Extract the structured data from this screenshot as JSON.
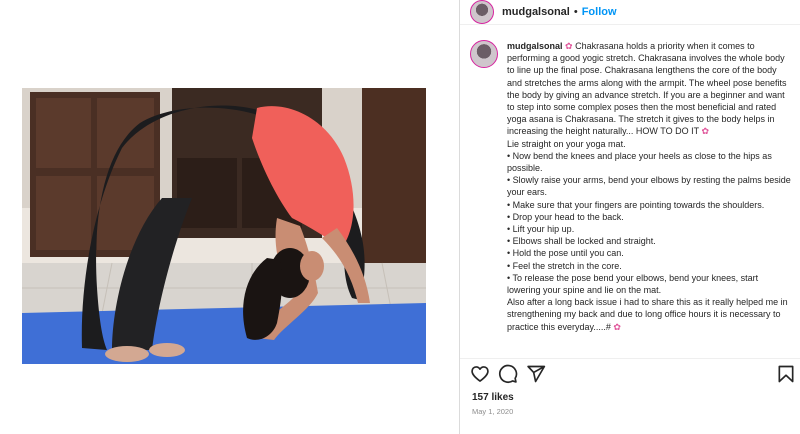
{
  "post": {
    "username": "mudgalsonal",
    "separator": "•",
    "follow_label": "Follow",
    "caption_paragraphs": [
      "Chakrasana holds a priority when it comes to performing a good yogic stretch. Chakrasana involves the whole body to line up the final pose. Chakrasana lengthens the core of the body and stretches the arms along with the armpit. The wheel pose benefits the body by giving an advance stretch. If you are a beginner and want to step into some complex poses then the most beneficial and rated yoga asana is Chakrasana. The stretch it gives to the body helps in increasing the height naturally... HOW TO DO IT",
      "Lie straight on your yoga mat.",
      "• Now bend the knees and place your heels as close to the hips as possible.",
      "• Slowly raise your arms, bend your elbows by resting the palms beside your ears.",
      "• Make sure that your fingers are pointing towards the shoulders.",
      "• Drop your head to the back.",
      "• Lift your hip up.",
      "• Elbows shall be locked and straight.",
      "• Hold the pose until you can.",
      "• Feel the stretch in the core.",
      "• To release the pose bend your elbows, bend your knees, start lowering your spine and lie on the mat.",
      "Also after a long back issue i had to share this as it really helped me in strengthening my back and due to long office hours it is necessary to practice this everyday.....#"
    ],
    "likes": "157 likes",
    "date": "May 1, 2020"
  },
  "icons": {
    "more": "more-options-icon",
    "like": "heart-icon",
    "comment": "comment-icon",
    "share": "share-icon",
    "save": "bookmark-icon",
    "flower": "flower-emoji-icon"
  },
  "colors": {
    "link": "#0095f6",
    "text": "#262626",
    "muted": "#8e8e8e",
    "mat": "#3f6fd6",
    "shirt": "#f0605a"
  }
}
